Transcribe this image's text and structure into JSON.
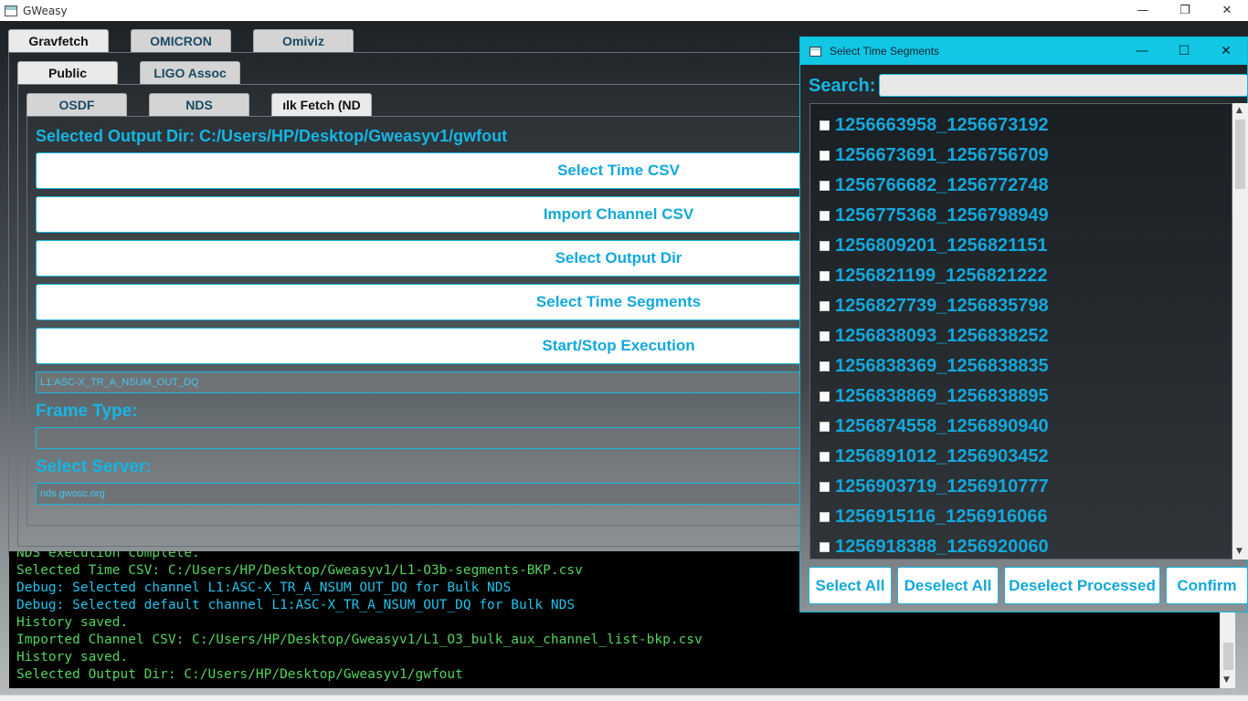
{
  "window": {
    "title": "GWeasy",
    "controls": {
      "minimize": "—",
      "restore": "❐",
      "close": "✕"
    }
  },
  "tabs_top": [
    "Gravfetch",
    "OMICRON",
    "Omiviz"
  ],
  "tabs_second": [
    "Public",
    "LIGO Assoc"
  ],
  "tabs_third": [
    "OSDF",
    "NDS",
    "ılk Fetch (ND"
  ],
  "output_dir_label": "Selected Output Dir: C:/Users/HP/Desktop/Gweasyv1/gwfout",
  "buttons": {
    "select_time_csv": "Select Time CSV",
    "import_channel_csv": "Import Channel CSV",
    "select_output_dir": "Select Output Dir",
    "select_time_segments": "Select Time Segments",
    "start_stop": "Start/Stop Execution"
  },
  "channel_field": "L1:ASC-X_TR_A_NSUM_OUT_DQ",
  "frame_type_label": "Frame Type:",
  "frame_type_value": "",
  "server_label": "Select Server:",
  "server_value": "nds.gwosc.org",
  "console": [
    {
      "text": "NDS execution complete.",
      "color": "green"
    },
    {
      "text": "Selected Time CSV: C:/Users/HP/Desktop/Gweasyv1/L1-O3b-segments-BKP.csv",
      "color": "green"
    },
    {
      "text": "Debug: Selected channel L1:ASC-X_TR_A_NSUM_OUT_DQ for Bulk NDS",
      "color": "cyan"
    },
    {
      "text": "Debug: Selected default channel L1:ASC-X_TR_A_NSUM_OUT_DQ for Bulk NDS",
      "color": "cyan"
    },
    {
      "text": "History saved.",
      "color": "green"
    },
    {
      "text": "Imported Channel CSV: C:/Users/HP/Desktop/Gweasyv1/L1_O3_bulk_aux_channel_list-bkp.csv",
      "color": "green"
    },
    {
      "text": "History saved.",
      "color": "green"
    },
    {
      "text": "Selected Output Dir: C:/Users/HP/Desktop/Gweasyv1/gwfout",
      "color": "green"
    }
  ],
  "dialog": {
    "title": "Select Time Segments",
    "search_label": "Search:",
    "search_value": "",
    "segments": [
      "1256663958_1256673192",
      "1256673691_1256756709",
      "1256766682_1256772748",
      "1256775368_1256798949",
      "1256809201_1256821151",
      "1256821199_1256821222",
      "1256827739_1256835798",
      "1256838093_1256838252",
      "1256838369_1256838835",
      "1256838869_1256838895",
      "1256874558_1256890940",
      "1256891012_1256903452",
      "1256903719_1256910777",
      "1256915116_1256916066",
      "1256918388_1256920060"
    ],
    "buttons": {
      "select_all": "Select All",
      "deselect_all": "Deselect All",
      "deselect_processed": "Deselect Processed",
      "confirm": "Confirm"
    }
  },
  "colors": {
    "accent": "#15b6e4",
    "dialog_titlebar": "#11c7e3",
    "console_green": "#53d35f",
    "console_cyan": "#1ec3ec"
  }
}
